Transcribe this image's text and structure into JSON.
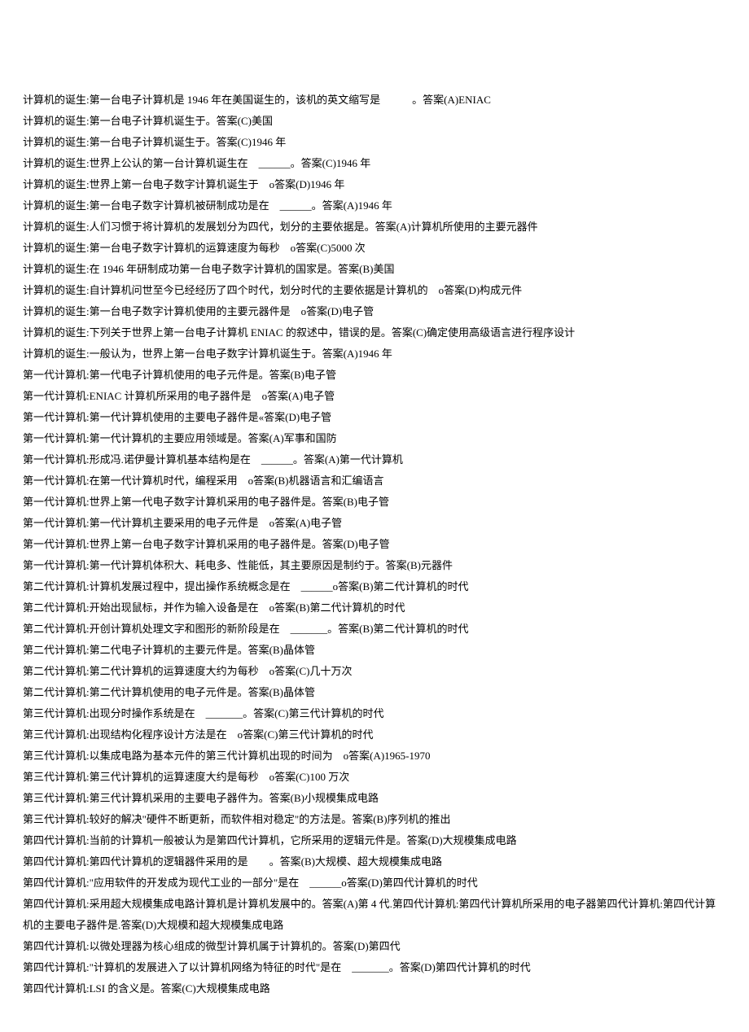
{
  "lines": [
    "计算机的诞生:第一台电子计算机是 1946 年在美国诞生的，该机的英文缩写是　　　。答案(A)ENIAC",
    "计算机的诞生:第一台电子计算机诞生于。答案(C)美国",
    "计算机的诞生:第一台电子计算机诞生于。答案(C)1946 年",
    "计算机的诞生:世界上公认的第一台计算机诞生在　______。答案(C)1946 年",
    "计算机的诞生:世界上第一台电子数字计算机诞生于　o答案(D)1946 年",
    "计算机的诞生:第一台电子数字计算机被研制成功是在　______。答案(A)1946 年",
    "计算机的诞生:人们习惯于将计算机的发展划分为四代，划分的主要依据是。答案(A)计算机所使用的主要元器件",
    "计算机的诞生:第一台电子数字计算机的运算速度为每秒　o答案(C)5000 次",
    "计算机的诞生:在 1946 年研制成功第一台电子数字计算机的国家是。答案(B)美国",
    "计算机的诞生:自计算机问世至今已经经历了四个时代，划分时代的主要依据是计算机的　o答案(D)构成元件",
    "计算机的诞生:第一台电子数字计算机使用的主要元器件是　o答案(D)电子管",
    "计算机的诞生:下列关于世界上第一台电子计算机 ENIAC 的叙述中，错误的是。答案(C)确定使用高级语言进行程序设计",
    "计算机的诞生:一般认为，世界上第一台电子数字计算机诞生于。答案(A)1946 年",
    "第一代计算机:第一代电子计算机使用的电子元件是。答案(B)电子管",
    "第一代计算机:ENIAC 计算机所采用的电子器件是　o答案(A)电子管",
    "第一代计算机:第一代计算机使用的主要电子器件是«答案(D)电子管",
    "第一代计算机:第一代计算机的主要应用领域是。答案(A)军事和国防",
    "第一代计算机:形成冯.诺伊曼计算机基本结构是在　______。答案(A)第一代计算机",
    "第一代计算机:在第一代计算机时代，编程采用　o答案(B)机器语言和汇编语言",
    "第一代计算机:世界上第一代电子数字计算机采用的电子器件是。答案(B)电子管",
    "第一代计算机:第一代计算机主要采用的电子元件是　o答案(A)电子管",
    "第一代计算机:世界上第一台电子数字计算机采用的电子器件是。答案(D)电子管",
    "第一代计算机:第一代计算机体积大、耗电多、性能低，其主要原因是制约于。答案(B)元器件",
    "第二代计算机:计算机发展过程中，提出操作系统概念是在　______o答案(B)第二代计算机的时代",
    "第二代计算机:开始出现鼠标，并作为输入设备是在　o答案(B)第二代计算机的时代",
    "第二代计算机:开创计算机处理文字和图形的新阶段是在　_______。答案(B)第二代计算机的时代",
    "第二代计算机:第二代电子计算机的主要元件是。答案(B)晶体管",
    "第二代计算机:第二代计算机的运算速度大约为每秒　o答案(C)几十万次",
    "第二代计算机:第二代计算机使用的电子元件是。答案(B)晶体管",
    "第三代计算机:出现分时操作系统是在　_______。答案(C)第三代计算机的时代",
    "第三代计算机:出现结构化程序设计方法是在　o答案(C)第三代计算机的时代",
    "第三代计算机:以集成电路为基本元件的第三代计算机出现的时间为　o答案(A)1965-1970",
    "第三代计算机:第三代计算机的运算速度大约是每秒　o答案(C)100 万次",
    "第三代计算机:第三代计算机采用的主要电子器件为。答案(B)小规模集成电路",
    "第三代计算机:较好的解决\"硬件不断更新，而软件相对稳定\"的方法是。答案(B)序列机的推出",
    "第四代计算机:当前的计算机一般被认为是第四代计算机，它所采用的逻辑元件是。答案(D)大规模集成电路",
    "第四代计算机:第四代计算机的逻辑器件采用的是　　。答案(B)大规模、超大规模集成电路",
    "第四代计算机:\"应用软件的开发成为现代工业的一部分\"是在　______o答案(D)第四代计算机的时代",
    "第四代计算机:采用超大规模集成电路计算机是计算机发展中的。答案(A)第 4 代.第四代计算机:第四代计算机所采用的电子器第四代计算机:第四代计算机的主要电子器件是.答案(D)大规模和超大规模集成电路",
    "第四代计算机:以微处理器为核心组成的微型计算机属于计算机的。答案(D)第四代",
    "第四代计算机:\"计算机的发展进入了以计算机网络为特征的时代\"是在　_______。答案(D)第四代计算机的时代",
    "第四代计算机:LSI 的含义是。答案(C)大规模集成电路"
  ]
}
